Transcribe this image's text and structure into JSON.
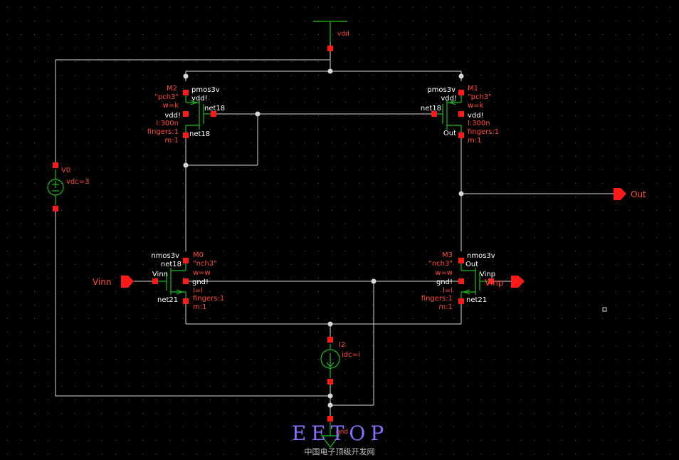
{
  "colors": {
    "background": "#000000",
    "grid": "#5c5c5c",
    "wire": "#d8d8d8",
    "pin": "#ff1a1a",
    "device": "#19c019",
    "label_red": "#ff4a3d",
    "label_white": "#ffffff",
    "watermark": "#8a6cff"
  },
  "icons": [
    "vdd-supply-symbol",
    "voltage-source-symbol",
    "current-source-symbol",
    "ground-symbol",
    "pin-arrow-symbol"
  ],
  "supply": {
    "vdd": "vdd",
    "gnd": "gnd"
  },
  "pins": {
    "vinn": "Vinn",
    "vinp": "Vinp",
    "out": "Out"
  },
  "sources": {
    "v0": {
      "name": "V0",
      "value": "vdc=3"
    },
    "i2": {
      "name": "I2",
      "value": "idc=i"
    }
  },
  "devices": {
    "m2": {
      "name": "M2",
      "model": "pmos3v",
      "cell": "\"pch3\"",
      "w": "w=k",
      "l": "l:300n",
      "fingers": "fingers:1",
      "m": "m:1",
      "term_s": "vdd!",
      "term_b": "vdd!",
      "term_g": "net18",
      "term_d": "net18"
    },
    "m1": {
      "name": "M1",
      "model": "pmos3v",
      "cell": "\"pch3\"",
      "w": "w=k",
      "l": "l:300n",
      "fingers": "fingers:1",
      "m": "m:1",
      "term_s": "vdd!",
      "term_b": "vdd!",
      "term_g": "net18",
      "term_d": "Out"
    },
    "m0": {
      "name": "M0",
      "model": "nmos3v",
      "cell": "\"nch3\"",
      "w": "w=w",
      "l": "l=l",
      "fingers": "fingers:1",
      "m": "m:1",
      "term_d": "net18",
      "term_g": "Vinn",
      "term_b": "gnd!",
      "term_s": "net21"
    },
    "m3": {
      "name": "M3",
      "model": "nmos3v",
      "cell": "\"nch3\"",
      "w": "w=w",
      "l": "l=l",
      "fingers": "fingers:1",
      "m": "m:1",
      "term_d": "Out",
      "term_g": "Vinp",
      "term_b": "gnd!",
      "term_s": "net21"
    }
  },
  "nets": {
    "net18": "net18"
  },
  "watermark": {
    "brand": "EETOP",
    "subtitle": "中国电子顶级开发网"
  }
}
